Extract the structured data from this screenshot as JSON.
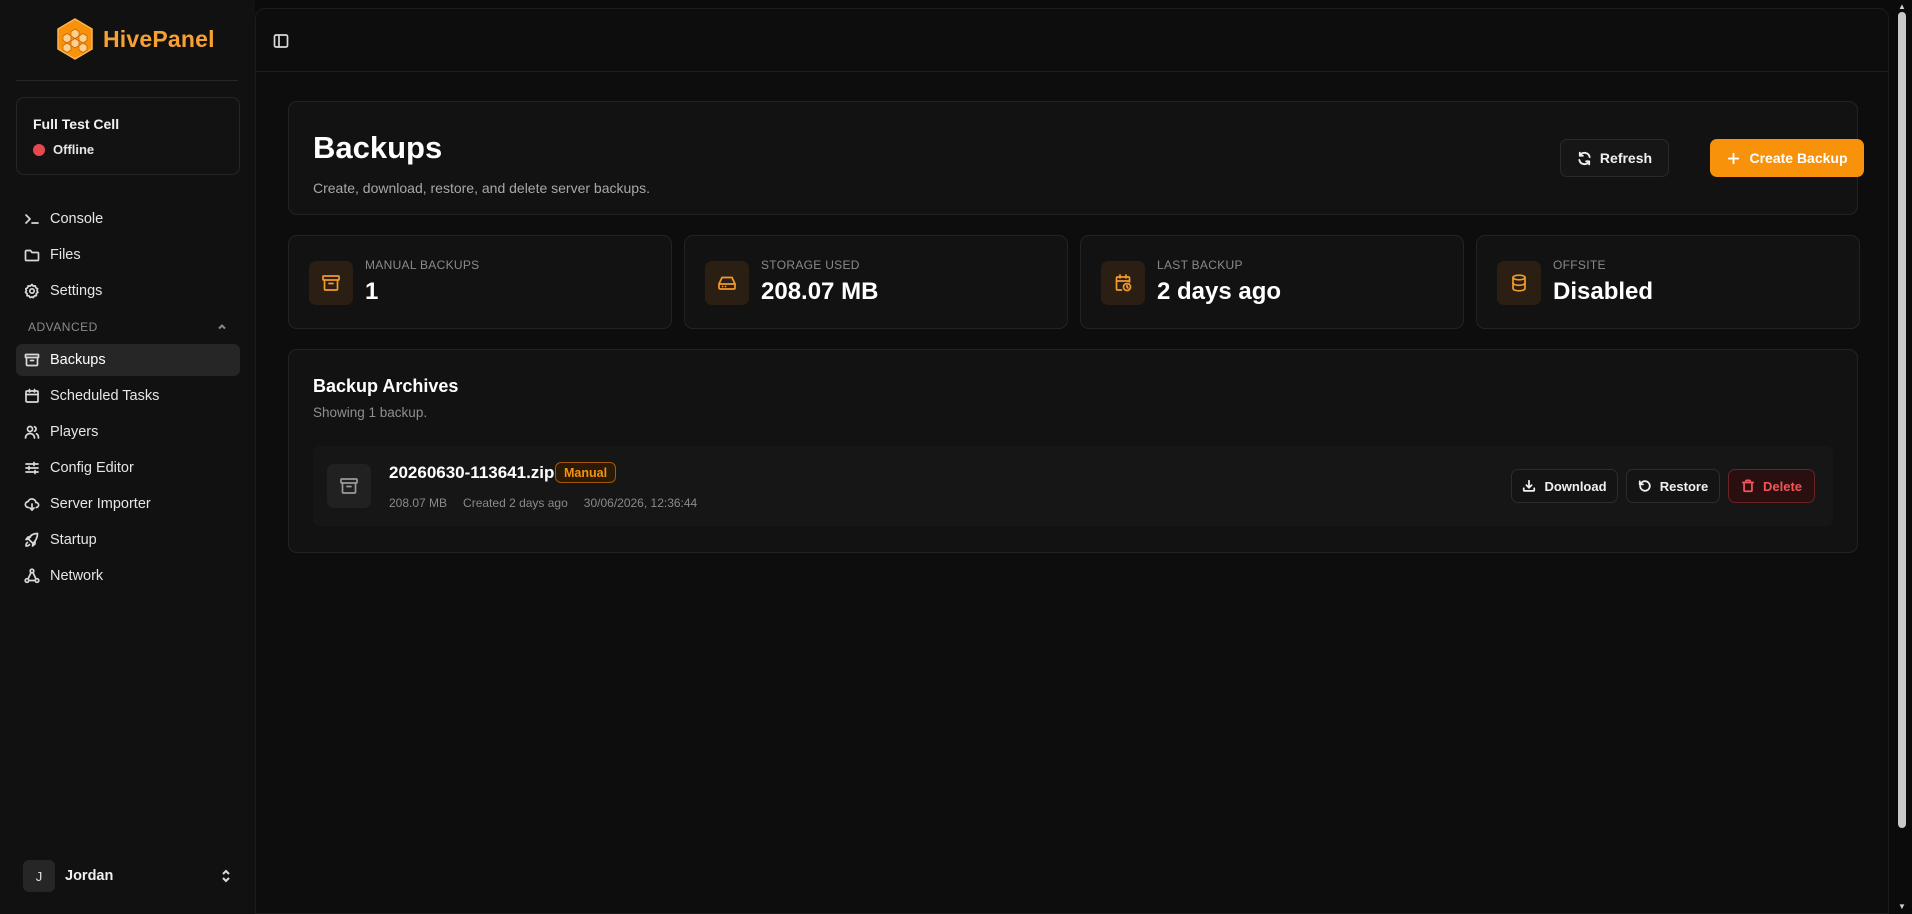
{
  "brand": {
    "name": "HivePanel",
    "accent": "#f7920a"
  },
  "server": {
    "name": "Full Test Cell",
    "status": "Offline",
    "status_color": "#e5484d"
  },
  "nav": {
    "primary": [
      {
        "label": "Console",
        "icon": "terminal-icon"
      },
      {
        "label": "Files",
        "icon": "folder-icon"
      },
      {
        "label": "Settings",
        "icon": "gear-icon"
      }
    ],
    "section_label": "ADVANCED",
    "advanced": [
      {
        "label": "Backups",
        "icon": "archive-icon",
        "active": true
      },
      {
        "label": "Scheduled Tasks",
        "icon": "calendar-icon"
      },
      {
        "label": "Players",
        "icon": "users-icon"
      },
      {
        "label": "Config Editor",
        "icon": "sliders-icon"
      },
      {
        "label": "Server Importer",
        "icon": "cloud-download-icon"
      },
      {
        "label": "Startup",
        "icon": "rocket-icon"
      },
      {
        "label": "Network",
        "icon": "network-icon"
      }
    ]
  },
  "user": {
    "initial": "J",
    "name": "Jordan"
  },
  "page": {
    "title": "Backups",
    "subtitle": "Create, download, restore, and delete server backups.",
    "refresh_label": "Refresh",
    "create_label": "Create Backup"
  },
  "stats": [
    {
      "label": "MANUAL BACKUPS",
      "value": "1",
      "icon": "archive-icon"
    },
    {
      "label": "STORAGE USED",
      "value": "208.07 MB",
      "icon": "hard-drive-icon"
    },
    {
      "label": "LAST BACKUP",
      "value": "2 days ago",
      "icon": "calendar-clock-icon"
    },
    {
      "label": "OFFSITE",
      "value": "Disabled",
      "icon": "database-icon"
    }
  ],
  "archives": {
    "title": "Backup Archives",
    "count_text": "Showing 1 backup.",
    "items": [
      {
        "file": "20260630-113641.zip",
        "badge": "Manual",
        "size": "208.07 MB",
        "created": "Created 2 days ago",
        "timestamp": "30/06/2026, 12:36:44",
        "download_label": "Download",
        "restore_label": "Restore",
        "delete_label": "Delete"
      }
    ]
  }
}
